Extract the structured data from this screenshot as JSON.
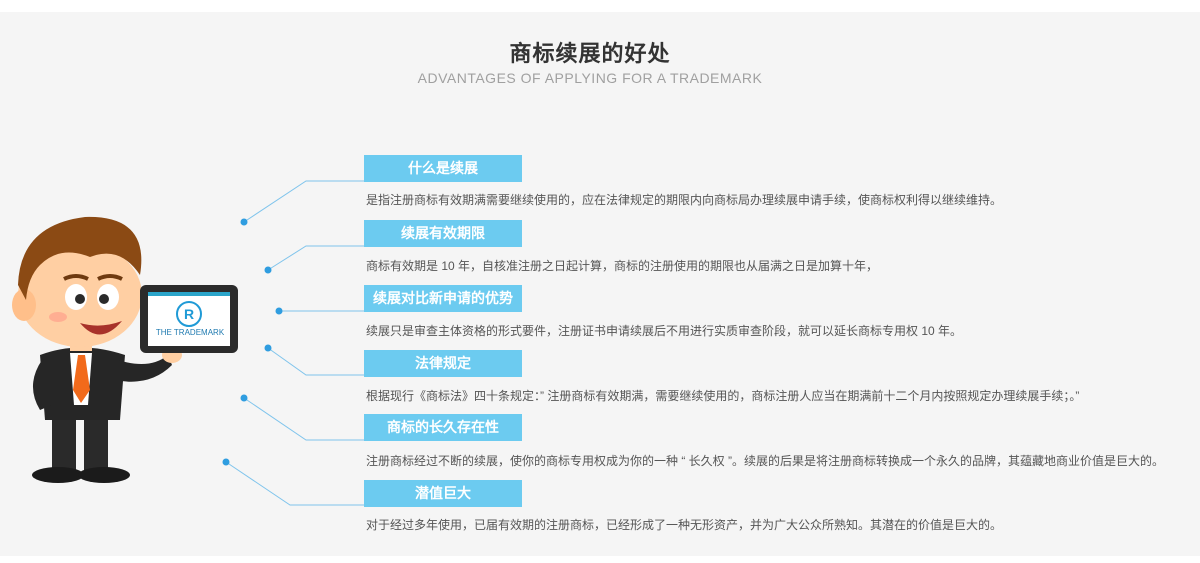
{
  "header": {
    "title": "商标续展的好处",
    "subtitle": "ADVANTAGES OF APPLYING FOR A TRADEMARK"
  },
  "illustration": {
    "tablet_logo": "THE TRADEMARK",
    "registered_mark": "R"
  },
  "items": [
    {
      "label": "什么是续展",
      "text": "是指注册商标有效期满需要继续使用的，应在法律规定的期限内向商标局办理续展申请手续，使商标权利得以继续维持。"
    },
    {
      "label": "续展有效期限",
      "text": "商标有效期是 10 年，自核准注册之日起计算，商标的注册使用的期限也从届满之日是加算十年，"
    },
    {
      "label": "续展对比新申请的优势",
      "text": "续展只是审查主体资格的形式要件，注册证书申请续展后不用进行实质审查阶段，就可以延长商标专用权 10 年。"
    },
    {
      "label": "法律规定",
      "text": "根据现行《商标法》四十条规定：” 注册商标有效期满，需要继续使用的，商标注册人应当在期满前十二个月内按照规定办理续展手续；。”"
    },
    {
      "label": "商标的长久存在性",
      "text": "注册商标经过不断的续展，使你的商标专用权成为你的一种 “ 长久权 ”。续展的后果是将注册商标转换成一个永久的品牌，其蕴藏地商业价值是巨大的。"
    },
    {
      "label": "潜值巨大",
      "text": "对于经过多年使用，已届有效期的注册商标，已经形成了一种无形资产，并为广大公众所熟知。其潜在的价值是巨大的。"
    }
  ],
  "colors": {
    "tag_background": "#6ccbf0",
    "connector": "#4aa8e0",
    "panel_background": "#f5f5f5"
  }
}
